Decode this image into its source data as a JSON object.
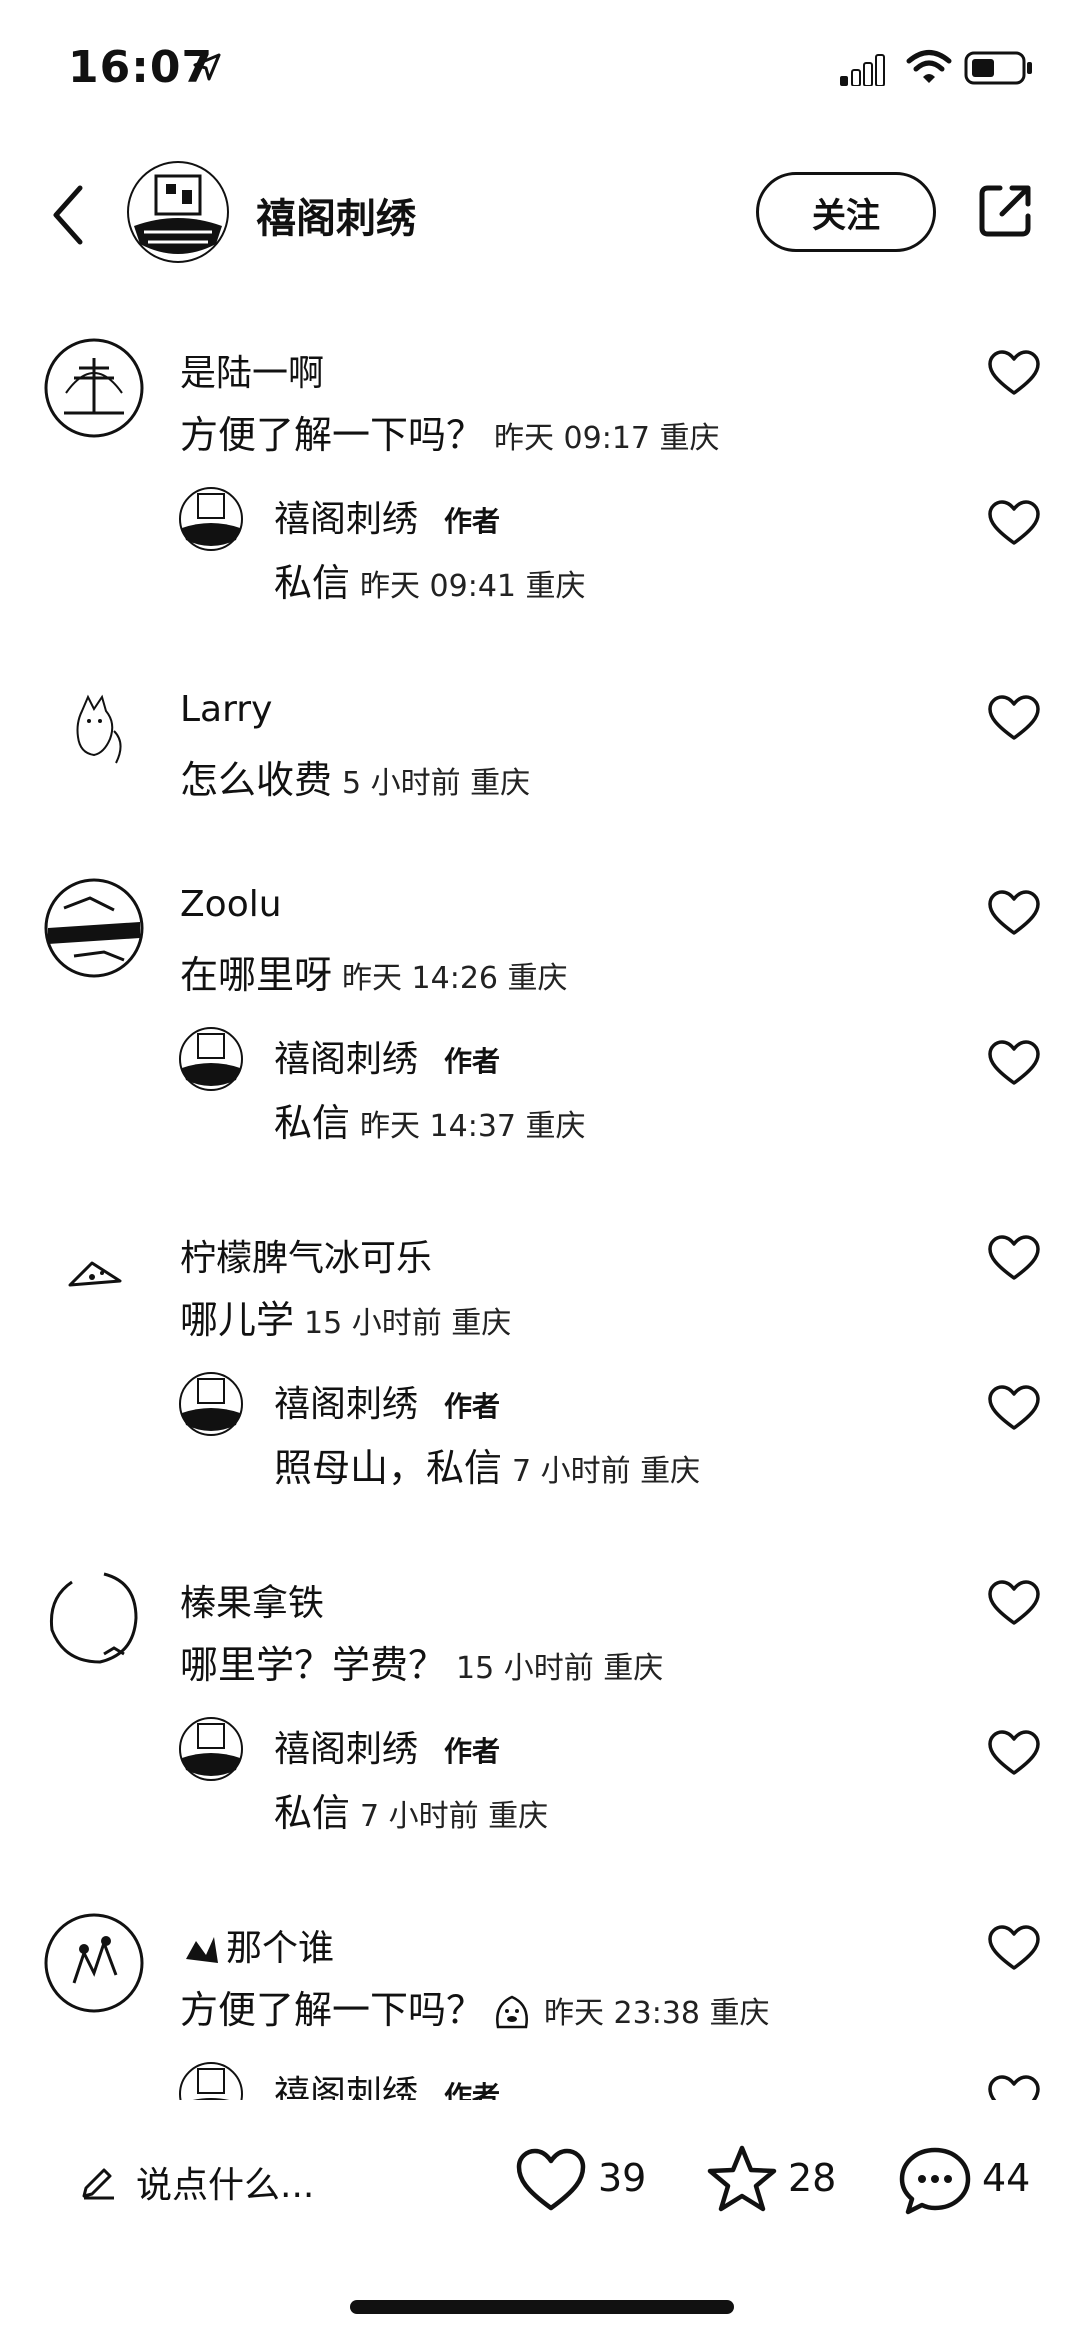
{
  "status_bar": {
    "time": "16:07"
  },
  "header": {
    "title": "禧阁刺绣",
    "follow_label": "关注"
  },
  "comments": [
    {
      "user": "是陆一啊",
      "text": "方便了解一下吗？",
      "meta": "昨天 09:17 重庆",
      "reply": {
        "user": "禧阁刺绣",
        "tag": "作者",
        "text": "私信",
        "meta": "昨天 09:41 重庆"
      }
    },
    {
      "user": "Larry",
      "text": "怎么收费",
      "meta": "5 小时前 重庆"
    },
    {
      "user": "Zoolu",
      "text": "在哪里呀",
      "meta": "昨天 14:26 重庆",
      "reply": {
        "user": "禧阁刺绣",
        "tag": "作者",
        "text": "私信",
        "meta": "昨天 14:37 重庆"
      }
    },
    {
      "user": "柠檬脾气冰可乐",
      "text": "哪儿学",
      "meta": "15 小时前 重庆",
      "reply": {
        "user": "禧阁刺绣",
        "tag": "作者",
        "text": "照母山，私信",
        "meta": "7 小时前 重庆"
      }
    },
    {
      "user": "榛果拿铁",
      "text": "哪里学？学费？",
      "meta": "15 小时前 重庆",
      "reply": {
        "user": "禧阁刺绣",
        "tag": "作者",
        "text": "私信",
        "meta": "7 小时前 重庆"
      }
    },
    {
      "user": "那个谁",
      "text": "方便了解一下吗？",
      "meta": "昨天 23:38 重庆",
      "reply": {
        "user": "禧阁刺绣",
        "tag": "作者"
      }
    }
  ],
  "bottom_bar": {
    "input_placeholder": "说点什么...",
    "likes": "39",
    "stars": "28",
    "comments": "44"
  },
  "icons": [
    "location-arrow-icon",
    "signal-icon",
    "wifi-icon",
    "battery-icon",
    "back-icon",
    "share-icon",
    "heart-icon",
    "pen-icon",
    "star-icon",
    "chat-icon"
  ]
}
